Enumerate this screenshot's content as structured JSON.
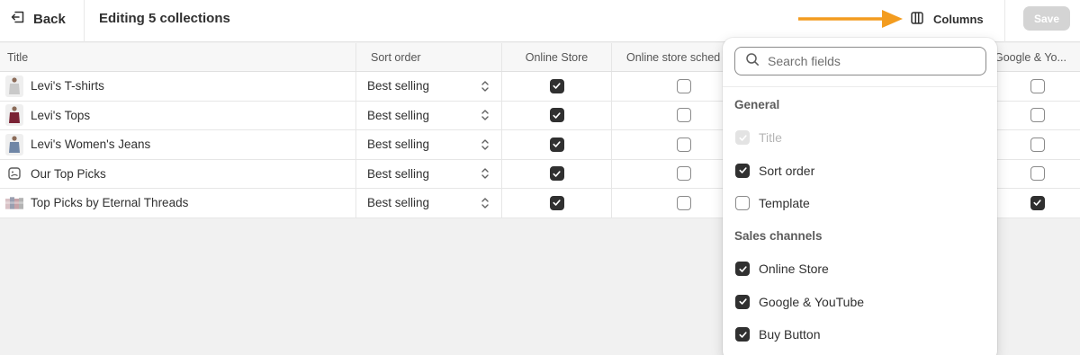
{
  "topbar": {
    "back_label": "Back",
    "title": "Editing 5 collections",
    "columns_label": "Columns",
    "save_label": "Save"
  },
  "table": {
    "headers": {
      "title": "Title",
      "sort_order": "Sort order",
      "online_store": "Online Store",
      "online_store_scheduled": "Online store sched",
      "google": "Google & Yo..."
    },
    "rows": [
      {
        "title": "Levi's T-shirts",
        "sort": "Best selling",
        "online_store": true,
        "scheduled": false,
        "google": false,
        "thumb": "tshirt",
        "thumb_color": "#c9c9c9"
      },
      {
        "title": "Levi's Tops",
        "sort": "Best selling",
        "online_store": true,
        "scheduled": false,
        "google": false,
        "thumb": "top",
        "thumb_color": "#7a2335"
      },
      {
        "title": "Levi's Women's Jeans",
        "sort": "Best selling",
        "online_store": true,
        "scheduled": false,
        "google": false,
        "thumb": "jeans",
        "thumb_color": "#6f86a6"
      },
      {
        "title": "Our Top Picks",
        "sort": "Best selling",
        "online_store": true,
        "scheduled": false,
        "google": false,
        "thumb": "image-icon",
        "thumb_color": "#ffffff"
      },
      {
        "title": "Top Picks by Eternal Threads",
        "sort": "Best selling",
        "online_store": true,
        "scheduled": false,
        "google": true,
        "thumb": "collage",
        "thumb_color": "#c7a3a8"
      }
    ]
  },
  "columns_popover": {
    "search_placeholder": "Search fields",
    "general_label": "General",
    "general_options": [
      {
        "label": "Title",
        "checked": true,
        "disabled": true
      },
      {
        "label": "Sort order",
        "checked": true,
        "disabled": false
      },
      {
        "label": "Template",
        "checked": false,
        "disabled": false
      }
    ],
    "sales_label": "Sales channels",
    "sales_options": [
      {
        "label": "Online Store",
        "checked": true
      },
      {
        "label": "Google & YouTube",
        "checked": true
      },
      {
        "label": "Buy Button",
        "checked": true
      }
    ]
  },
  "colors": {
    "accent_arrow": "#f39c1f",
    "checkbox_on": "#303030",
    "save_disabled": "#d4d4d4"
  }
}
